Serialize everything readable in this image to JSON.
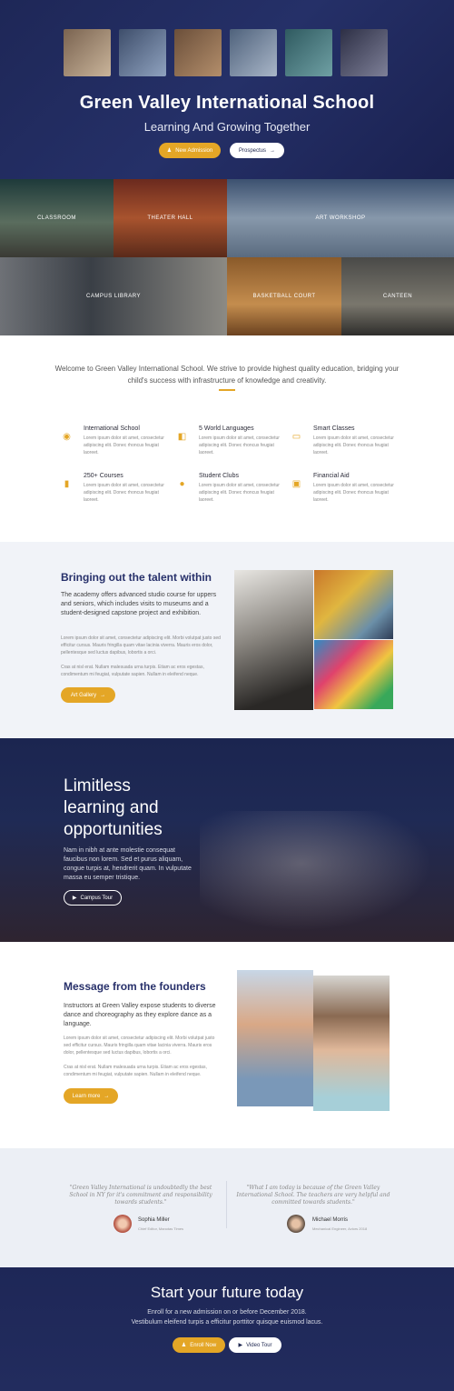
{
  "hero": {
    "title": "Green Valley International School",
    "subtitle": "Learning And Growing Together",
    "admission_label": "New Admission",
    "prospectus_label": "Prospectus",
    "thumbs": [
      "#6b5a4a",
      "#4a5f7e",
      "#8b6e52",
      "#5f6f85",
      "#3f6a6f",
      "#4d4f66"
    ]
  },
  "facilities": {
    "classroom": "CLASSROOM",
    "theater": "THEATER HALL",
    "art": "ART WORKSHOP",
    "library": "CAMPUS LIBRARY",
    "basketball": "BASKETBALL COURT",
    "canteen": "CANTEEN"
  },
  "welcome": {
    "intro": "Welcome to Green Valley International School. We strive to provide highest quality education, bridging your child's success with infrastructure of knowledge and creativity.",
    "features": [
      {
        "icon": "globe-icon",
        "title": "International School",
        "desc": "Lorem ipsum dolor sit amet, consectetur adipiscing elit. Donec rhoncus feugiat laoreet."
      },
      {
        "icon": "language-icon",
        "title": "5 World Languages",
        "desc": "Lorem ipsum dolor sit amet, consectetur adipiscing elit. Donec rhoncus feugiat laoreet."
      },
      {
        "icon": "laptop-icon",
        "title": "Smart Classes",
        "desc": "Lorem ipsum dolor sit amet, consectetur adipiscing elit. Donec rhoncus feugiat laoreet."
      },
      {
        "icon": "book-icon",
        "title": "250+ Courses",
        "desc": "Lorem ipsum dolor sit amet, consectetur adipiscing elit. Donec rhoncus feugiat laoreet."
      },
      {
        "icon": "ball-icon",
        "title": "Student Clubs",
        "desc": "Lorem ipsum dolor sit amet, consectetur adipiscing elit. Donec rhoncus feugiat laoreet."
      },
      {
        "icon": "money-icon",
        "title": "Financial Aid",
        "desc": "Lorem ipsum dolor sit amet, consectetur adipiscing elit. Donec rhoncus feugiat laoreet."
      }
    ]
  },
  "talent": {
    "title": "Bringing out the talent within",
    "lead": "The academy offers advanced studio course for uppers and seniors, which includes visits to museums and a student-designed capstone project and exhibition.",
    "p1": "Lorem ipsum dolor sit amet, consectetur adipiscing elit. Morbi volutpat justo sed efficitur cursus. Mauris fringilla quam vitae lacinia viverra. Mauris eros dolor, pellentesque sed luctus dapibus, lobortis a orci.",
    "p2": "Cras at nisl erat. Nullam malesuada urna turpis. Etiam ac eros egestas, condimentum mi feugiat, vulputate sapien. Nullam in eleifend neque.",
    "button": "Art Gallery"
  },
  "perf": {
    "title1": "Limitless",
    "title2": "learning and",
    "title3": "opportunities",
    "text": "Nam in nibh at ante molestie consequat faucibus non lorem. Sed et purus aliquam, congue turpis at, hendrerit quam. In vulputate massa eu semper tristique.",
    "button": "Campus Tour"
  },
  "founders": {
    "title": "Message from the founders",
    "lead": "Instructors at Green Valley expose students to diverse dance and choreography as they explore dance as a language.",
    "p1": "Lorem ipsum dolor sit amet, consectetur adipiscing elit. Morbi volutpat justo sed efficitur cursus. Mauris fringilla quam vitae lacinia viverra. Mauris eros dolor, pellentesque sed luctus dapibus, lobortis a orci.",
    "p2": "Cras at nisl erat. Nullam malesuada urna turpis. Etiam ac eros egestas, condimentum mi feugiat, vulputate sapien. Nullam in eleifend neque.",
    "button": "Learn more"
  },
  "testimonials": [
    {
      "quote": "\"Green Valley International is undoubtedly the best School in NY for it's commitment and responsibility towards students.\"",
      "name": "Sophia Miller",
      "role": "Chief Editor, Manotas Times"
    },
    {
      "quote": "\"What I am today is because of the Green Valley International School. The teachers are very helpful and committed towards students.\"",
      "name": "Michael Morris",
      "role": "Mechanical Engineer, Aviors 2018"
    }
  ],
  "cta": {
    "title": "Start your future today",
    "line1": "Enroll for a new admission on or before December 2018.",
    "line2": "Vestibulum eleifend turpis a efficitur porttitor quisque euismod lacus.",
    "enroll": "Enroll Now",
    "video": "Video Tour"
  },
  "colors": {
    "navy": "#1e2757",
    "accent": "#e4a626",
    "heading": "#27306a"
  }
}
